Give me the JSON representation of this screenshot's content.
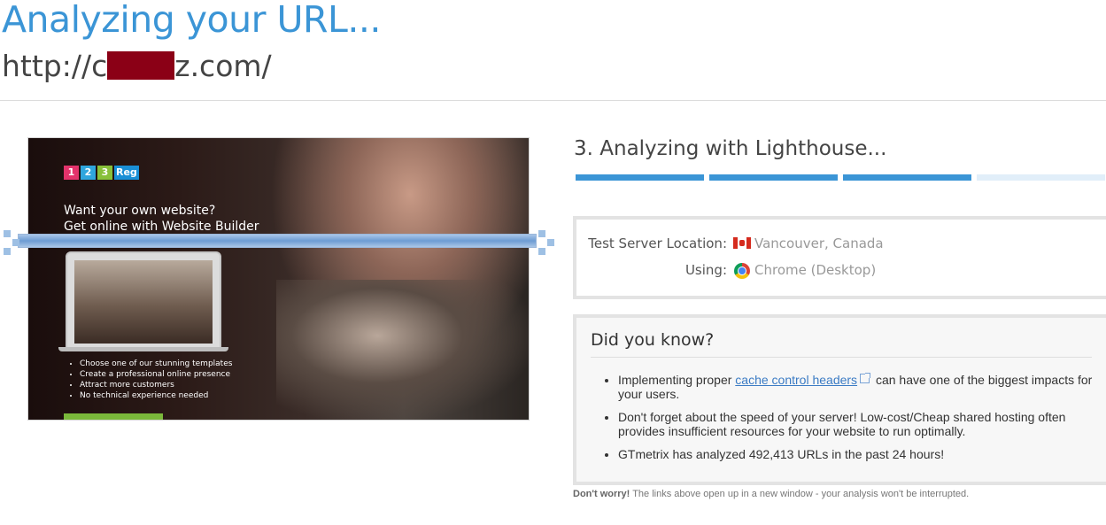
{
  "header": {
    "title": "Analyzing your URL...",
    "url_prefix": "http://c",
    "url_suffix": "z.com/"
  },
  "preview": {
    "logo": [
      "1",
      "2",
      "3",
      "Reg"
    ],
    "promo_line1": "Want your own website?",
    "promo_line2": "Get online with Website Builder",
    "bullets": [
      "Choose one of our stunning templates",
      "Create a professional online presence",
      "Attract more customers",
      "No technical experience needed"
    ]
  },
  "analysis": {
    "step_title": "3. Analyzing with Lighthouse...",
    "progress": {
      "completed_steps": 3,
      "total_steps": 4
    }
  },
  "server": {
    "location_label": "Test Server Location:",
    "location_value": "Vancouver, Canada",
    "location_icon": "canada-flag-icon",
    "using_label": "Using:",
    "using_value": "Chrome (Desktop)",
    "using_icon": "chrome-icon"
  },
  "did_you_know": {
    "title": "Did you know?",
    "tip1_pre": "Implementing proper ",
    "tip1_link": "cache control headers",
    "tip1_post": " can have one of the biggest impacts for your users.",
    "tip2": "Don't forget about the speed of your server! Low-cost/Cheap shared hosting often provides insufficient resources for your website to run optimally.",
    "tip3": "GTmetrix has analyzed 492,413 URLs in the past 24 hours!"
  },
  "note": {
    "bold": "Don't worry!",
    "text": " The links above open up in a new window - your analysis won't be interrupted."
  },
  "colors": {
    "accent": "#3b95d6",
    "redaction": "#8b0016",
    "link": "#3b7bc4"
  }
}
